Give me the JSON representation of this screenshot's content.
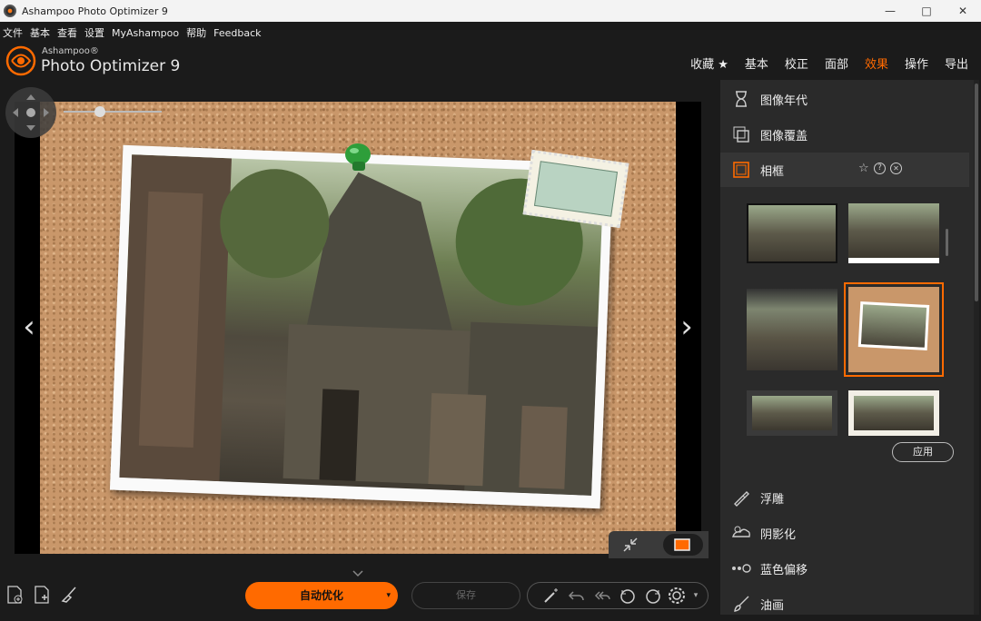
{
  "window": {
    "title": "Ashampoo Photo Optimizer 9",
    "controls": {
      "minimize": "—",
      "maximize": "□",
      "close": "✕"
    }
  },
  "menu": [
    "文件",
    "基本",
    "查看",
    "设置",
    "MyAshampoo",
    "帮助",
    "Feedback"
  ],
  "brand": {
    "small": "Ashampoo®",
    "big": "Photo Optimizer 9"
  },
  "topnav": [
    {
      "label": "收藏 ★",
      "active": false
    },
    {
      "label": "基本",
      "active": false
    },
    {
      "label": "校正",
      "active": false
    },
    {
      "label": "面部",
      "active": false
    },
    {
      "label": "效果",
      "active": true
    },
    {
      "label": "操作",
      "active": false
    },
    {
      "label": "导出",
      "active": false
    }
  ],
  "sidebar": {
    "items": [
      {
        "label": "图像年代",
        "icon": "hourglass-icon"
      },
      {
        "label": "图像覆盖",
        "icon": "overlay-icon"
      },
      {
        "label": "相框",
        "icon": "frame-icon",
        "active": true
      },
      {
        "label": "浮雕",
        "icon": "emboss-icon"
      },
      {
        "label": "阴影化",
        "icon": "shadow-icon"
      },
      {
        "label": "蓝色偏移",
        "icon": "blue-shift-icon"
      },
      {
        "label": "油画",
        "icon": "brush-icon"
      }
    ],
    "active_actions": [
      "favorite-icon",
      "help-icon",
      "close-icon"
    ],
    "apply_label": "应用",
    "frame_thumbnails_count": 6,
    "selected_thumbnail": 4
  },
  "bottom": {
    "auto_label": "自动优化",
    "save_label": "保存"
  },
  "colors": {
    "accent": "#ff6a00",
    "panel": "#2a2a2a",
    "bg": "#1b1b1b"
  }
}
